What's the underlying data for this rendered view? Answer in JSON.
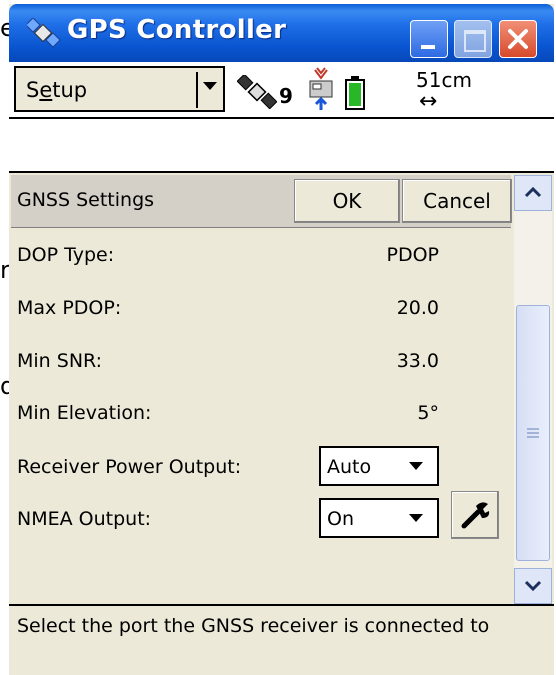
{
  "window": {
    "title": "GPS Controller"
  },
  "toolbar": {
    "menu_label_pre": "S",
    "menu_label_u": "e",
    "menu_label_post": "tup",
    "satellite_count": "9",
    "accuracy": "51cm",
    "accuracy_arrow": "↔"
  },
  "panel": {
    "title": "GNSS Settings",
    "ok_label": "OK",
    "cancel_label": "Cancel",
    "settings": [
      {
        "label": "DOP Type:",
        "value": "PDOP"
      },
      {
        "label": "Max PDOP:",
        "value": "20.0"
      },
      {
        "label": "Min SNR:",
        "value": "33.0"
      },
      {
        "label": "Min Elevation:",
        "value": "5°"
      }
    ],
    "receiver_power": {
      "label": "Receiver Power Output:",
      "value": "Auto"
    },
    "nmea": {
      "label": "NMEA Output:",
      "value": "On"
    }
  },
  "status": {
    "message": "Select the port the GNSS receiver is connected to"
  },
  "background_letters": [
    "e",
    "r",
    "d"
  ],
  "colors": {
    "titlebar": "#0954d0",
    "close": "#d8492b",
    "face": "#ece9d8"
  }
}
